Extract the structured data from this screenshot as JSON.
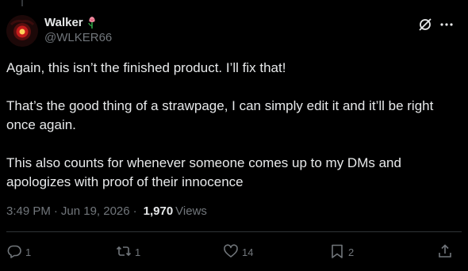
{
  "author": {
    "display_name": "Walker",
    "handle": "@WLKER66"
  },
  "tweet": {
    "paragraphs": [
      "Again, this isn’t the finished product. I’ll fix that!",
      "That’s the good thing of a strawpage, I can simply edit it and it’ll be right once again.",
      "This also counts for whenever someone comes up to my DMs and apologizes with proof of their innocence"
    ],
    "time": "3:49 PM",
    "separator": "·",
    "date": "Jun 19, 2026",
    "views_count": "1,970",
    "views_label": "Views"
  },
  "actions": {
    "replies": "1",
    "reposts": "1",
    "likes": "14",
    "bookmarks": "2"
  },
  "icons": {
    "name_badge": "flower-icon",
    "grok": "grok-icon",
    "more": "more-icon",
    "reply": "reply-icon",
    "repost": "repost-icon",
    "like": "heart-icon",
    "bookmark": "bookmark-icon",
    "share": "share-icon"
  },
  "colors": {
    "background": "#000000",
    "text": "#e7e9ea",
    "secondary": "#71767b",
    "divider": "#2f3336"
  }
}
